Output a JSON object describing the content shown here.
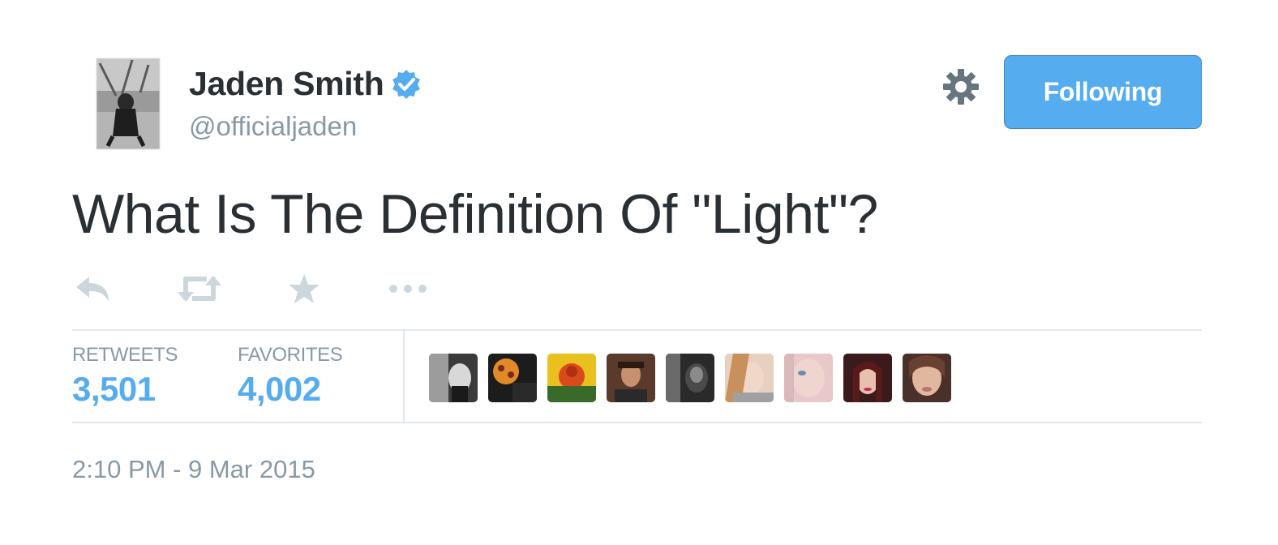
{
  "tweet": {
    "author": {
      "name": "Jaden Smith",
      "handle": "@officialjaden",
      "verified": true,
      "avatar_icon": "profile-photo"
    },
    "text": "What Is The Definition Of \"Light\"?",
    "actions": [
      {
        "name": "reply",
        "icon": "reply-icon"
      },
      {
        "name": "retweet",
        "icon": "retweet-icon"
      },
      {
        "name": "favorite",
        "icon": "star-icon"
      },
      {
        "name": "more",
        "icon": "ellipsis-icon"
      }
    ],
    "stats": {
      "retweets_label": "RETWEETS",
      "retweets_count": "3,501",
      "favorites_label": "FAVORITES",
      "favorites_count": "4,002"
    },
    "favoriters_count_shown": 9,
    "timestamp": "2:10 PM - 9 Mar 2015"
  },
  "header": {
    "settings_icon": "gear-icon",
    "follow_button_label": "Following"
  },
  "colors": {
    "accent": "#55acee",
    "text": "#292f33",
    "muted": "#8899a6",
    "icon_muted": "#ccd6dd",
    "divider": "#e1e8ed",
    "gear": "#66757f",
    "verified": "#55acee"
  }
}
